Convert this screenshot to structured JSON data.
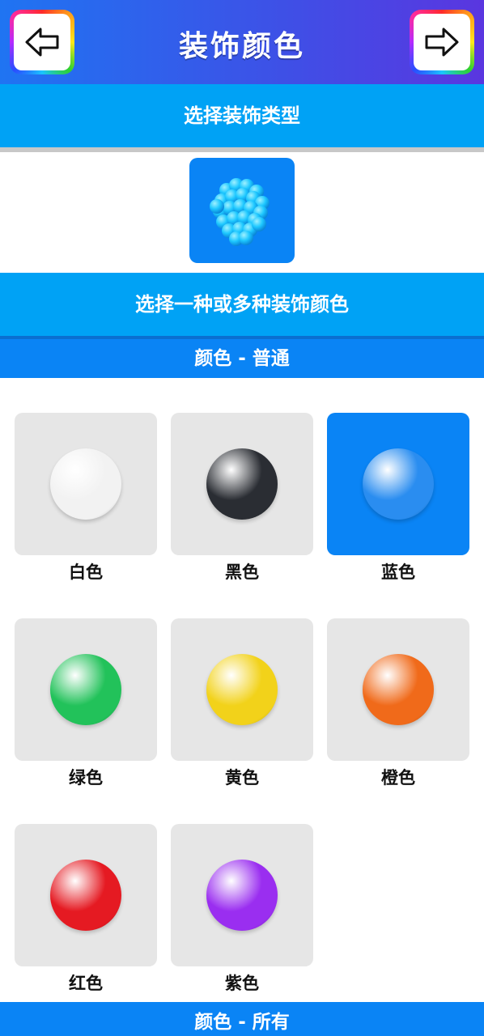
{
  "header": {
    "title": "装饰颜色",
    "back_icon": "arrow-left-icon",
    "forward_icon": "arrow-right-icon"
  },
  "decoration_type": {
    "section_label": "选择装饰类型",
    "selected_icon": "sphere-cluster-icon"
  },
  "colors": {
    "section_label": "选择一种或多种装饰颜色",
    "normal_title": "颜色 - 普通",
    "all_title": "颜色 - 所有",
    "items": [
      {
        "label": "白色",
        "color": "#f2f2f2",
        "selected": false
      },
      {
        "label": "黑色",
        "color": "#2a2d33",
        "selected": false
      },
      {
        "label": "蓝色",
        "color": "#2a8df0",
        "selected": true
      },
      {
        "label": "绿色",
        "color": "#22c25a",
        "selected": false
      },
      {
        "label": "黄色",
        "color": "#f2d21a",
        "selected": false
      },
      {
        "label": "橙色",
        "color": "#f06a1a",
        "selected": false
      },
      {
        "label": "红色",
        "color": "#e51a22",
        "selected": false
      },
      {
        "label": "紫色",
        "color": "#9a2ef0",
        "selected": false
      }
    ]
  },
  "theme": {
    "accent": "#00a2f5",
    "selected": "#0a84f5",
    "card": "#e6e6e6"
  }
}
